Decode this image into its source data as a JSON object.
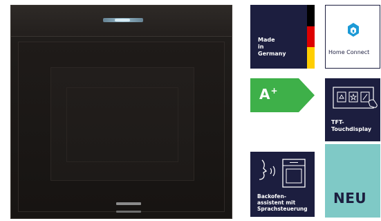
{
  "product": {
    "image_name": "built-in-oven-image"
  },
  "badges": {
    "made_in_germany": {
      "lines": [
        "Made",
        "in",
        "Germany"
      ],
      "flag_colors": [
        "#000000",
        "#dd0000",
        "#ffce00"
      ],
      "background": "#1c1e3f"
    },
    "home_connect": {
      "label": "Home Connect",
      "icon": "home-connect-icon",
      "color": "#1c1e3f"
    },
    "energy_class": {
      "label": "A",
      "superscript": "+",
      "color": "#3eb049"
    },
    "tft_touchdisplay": {
      "lines": [
        "TFT-",
        "Touchdisplay"
      ],
      "icon": "touch-display-icon",
      "background": "#1c1e3f"
    },
    "backofen_assistent": {
      "lines": [
        "Backofen-",
        "assistent mit",
        "Sprachsteuerung"
      ],
      "icon": "voice-oven-icon",
      "background": "#1c1e3f"
    },
    "neu": {
      "label": "NEU",
      "background": "#7fc9c6",
      "color": "#1c1e3f"
    }
  }
}
